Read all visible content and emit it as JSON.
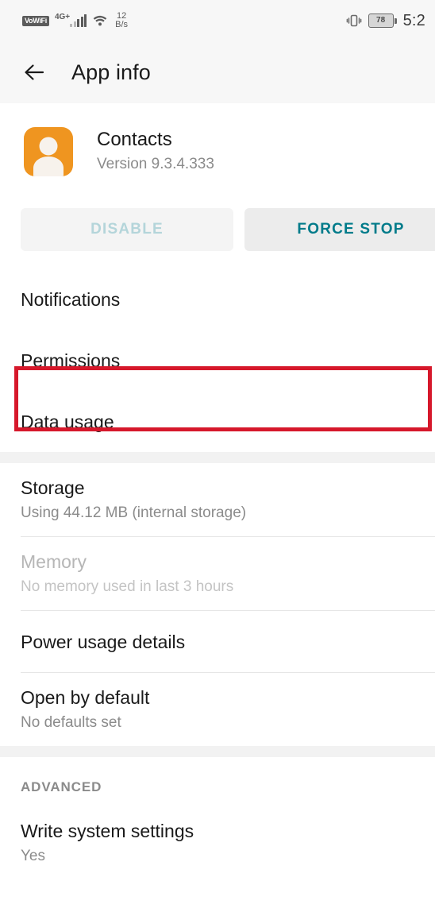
{
  "statusbar": {
    "vowifi_badge": "VoWiFi",
    "network_type": "4G+",
    "signal_icon": "signal-bars-icon",
    "wifi_icon": "wifi-icon",
    "data_speed_value": "12",
    "data_speed_unit": "B/s",
    "vibrate_icon": "vibrate-icon",
    "battery_level": "78",
    "clock": "5:2"
  },
  "header": {
    "back_icon": "back-arrow-icon",
    "title": "App info"
  },
  "app": {
    "icon_name": "contacts-app-icon",
    "name": "Contacts",
    "version": "Version 9.3.4.333"
  },
  "actions": {
    "disable_label": "DISABLE",
    "force_stop_label": "FORCE STOP"
  },
  "list": {
    "notifications": {
      "title": "Notifications"
    },
    "permissions": {
      "title": "Permissions"
    },
    "data_usage": {
      "title": "Data usage"
    },
    "storage": {
      "title": "Storage",
      "subtitle": "Using 44.12 MB (internal storage)"
    },
    "memory": {
      "title": "Memory",
      "subtitle": "No memory used in last 3 hours"
    },
    "power_usage": {
      "title": "Power usage details"
    },
    "open_by_default": {
      "title": "Open by default",
      "subtitle": "No defaults set"
    },
    "advanced_label": "ADVANCED",
    "write_system_settings": {
      "title": "Write system settings",
      "subtitle": "Yes"
    }
  },
  "annotation": {
    "target": "Permissions",
    "color": "#d6182b"
  },
  "colors": {
    "accent_teal": "#007b8a",
    "app_icon_orange": "#ef9520",
    "highlight_red": "#d6182b",
    "background": "#ffffff",
    "chrome": "#f7f7f7"
  }
}
